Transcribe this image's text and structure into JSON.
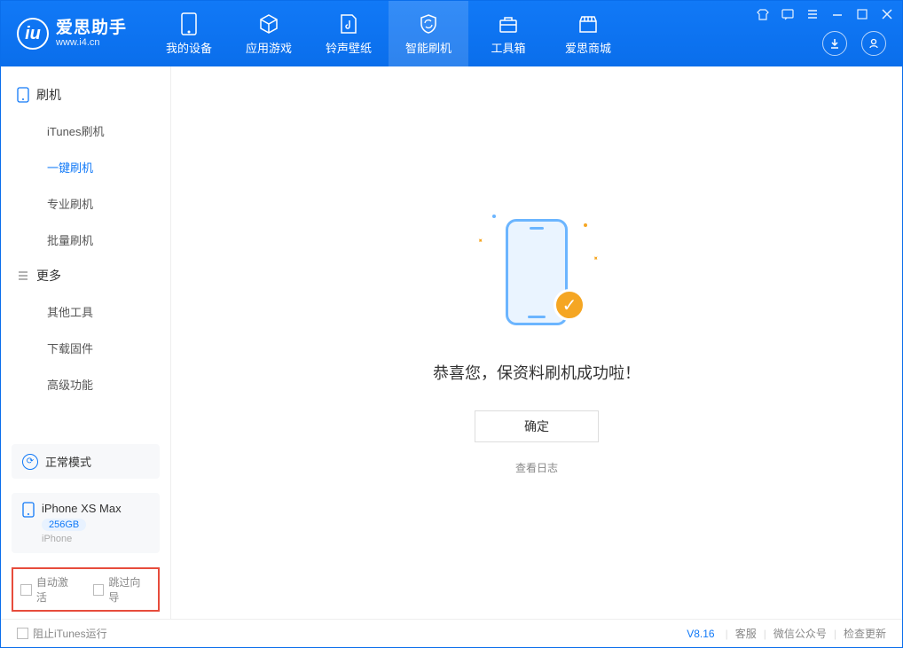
{
  "app": {
    "title": "爱思助手",
    "subtitle": "www.i4.cn"
  },
  "nav": {
    "items": [
      {
        "label": "我的设备"
      },
      {
        "label": "应用游戏"
      },
      {
        "label": "铃声壁纸"
      },
      {
        "label": "智能刷机"
      },
      {
        "label": "工具箱"
      },
      {
        "label": "爱思商城"
      }
    ]
  },
  "sidebar": {
    "group1": {
      "title": "刷机",
      "items": [
        "iTunes刷机",
        "一键刷机",
        "专业刷机",
        "批量刷机"
      ]
    },
    "group2": {
      "title": "更多",
      "items": [
        "其他工具",
        "下载固件",
        "高级功能"
      ]
    }
  },
  "device_mode": {
    "label": "正常模式"
  },
  "device": {
    "name": "iPhone XS Max",
    "capacity": "256GB",
    "type": "iPhone"
  },
  "bottom_options": {
    "auto_activate": "自动激活",
    "skip_guide": "跳过向导"
  },
  "main": {
    "success_message": "恭喜您，保资料刷机成功啦！",
    "ok_button": "确定",
    "view_log": "查看日志"
  },
  "footer": {
    "block_itunes": "阻止iTunes运行",
    "version": "V8.16",
    "support": "客服",
    "wechat": "微信公众号",
    "check_update": "检查更新"
  }
}
